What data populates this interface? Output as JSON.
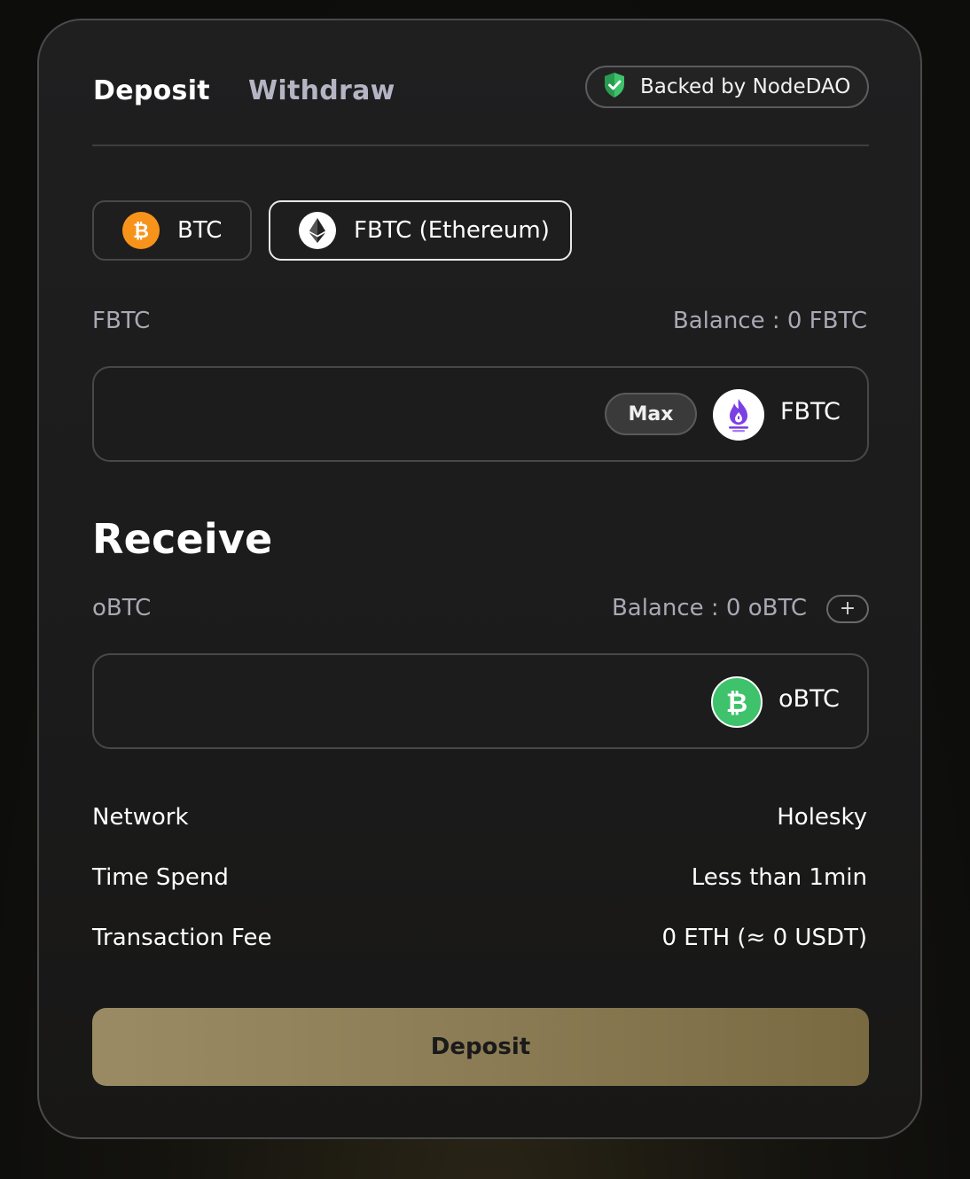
{
  "tabs": {
    "deposit": "Deposit",
    "withdraw": "Withdraw"
  },
  "badge": {
    "label": "Backed by NodeDAO",
    "icon": "shield-check-icon",
    "color": "#3ec26b"
  },
  "assets": [
    {
      "label": "BTC",
      "icon": "bitcoin-icon",
      "color": "#f7931a",
      "selected": false
    },
    {
      "label": "FBTC (Ethereum)",
      "icon": "ethereum-icon",
      "color": "#ffffff",
      "selected": true
    }
  ],
  "from": {
    "token_label": "FBTC",
    "balance": "Balance : 0 FBTC",
    "amount_value": "",
    "max_label": "Max",
    "token_name": "FBTC",
    "token_icon": "fbtc-flame-icon"
  },
  "receive": {
    "title": "Receive",
    "token_label": "oBTC",
    "balance": "Balance : 0 oBTC",
    "add_label": "+",
    "amount_value": "",
    "token_name": "oBTC",
    "token_icon": "obtc-icon",
    "token_color": "#3ec26b"
  },
  "details": [
    {
      "label": "Network",
      "value": "Holesky"
    },
    {
      "label": "Time Spend",
      "value": "Less than 1min"
    },
    {
      "label": "Transaction Fee",
      "value": "0 ETH (≈ 0 USDT)"
    }
  ],
  "submit": {
    "label": "Deposit"
  },
  "colors": {
    "accent": "#8c7c55",
    "muted_text": "#a9a9b5",
    "border": "#48484a"
  }
}
